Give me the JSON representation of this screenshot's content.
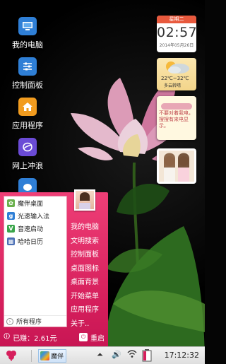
{
  "desktop": {
    "icons": [
      {
        "label": "我的电脑",
        "icon": "computer-icon"
      },
      {
        "label": "控制面板",
        "icon": "control-panel-icon"
      },
      {
        "label": "应用程序",
        "icon": "home-apps-icon"
      },
      {
        "label": "网上冲浪",
        "icon": "browser-icon"
      }
    ]
  },
  "widgets": {
    "clock": {
      "weekday": "星期二",
      "time": "02:57",
      "date": "2014年05月26日"
    },
    "weather": {
      "temp": "22℃~32℃",
      "condition": "多云转晴"
    },
    "note": {
      "text": "不要对着我电，搜搜有来电显示。"
    }
  },
  "start_menu": {
    "items": [
      {
        "label": "魔伴桌面",
        "icon": "mobang-icon",
        "color": "#6ab04c"
      },
      {
        "label": "光速输入法",
        "icon": "keyboard-icon",
        "color": "#2f7fd6"
      },
      {
        "label": "音速启动",
        "icon": "v-launcher-icon",
        "color": "#3aa54a"
      },
      {
        "label": "哈哈日历",
        "icon": "calendar-icon",
        "color": "#4a6fb5"
      }
    ],
    "all_programs": "所有程序",
    "links": [
      "我的电脑",
      "文明搜索",
      "控制面板",
      "桌面图标",
      "桌面背景",
      "开始菜单",
      "应用程序",
      "关于.."
    ],
    "earned": "已赚：2.61元",
    "restart": "重启"
  },
  "taskbar": {
    "task_label": "魔伴",
    "time": "17:12:32"
  },
  "colors": {
    "accent": "#d61f5c",
    "taskbar": "#e6e6e6"
  }
}
